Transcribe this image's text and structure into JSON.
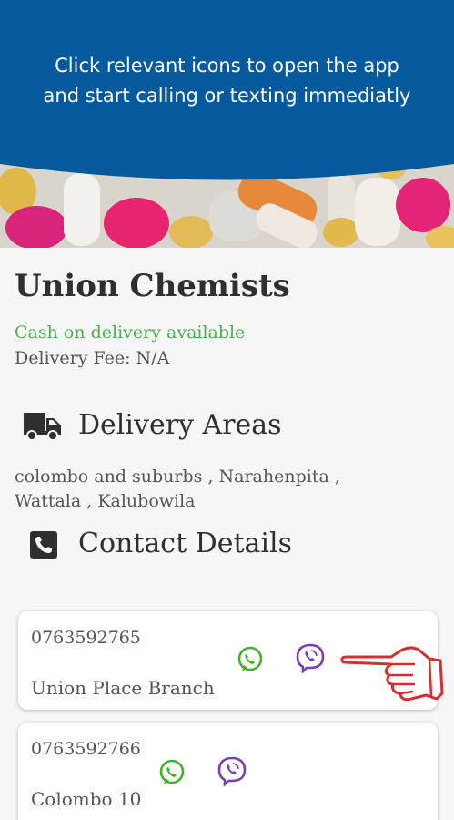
{
  "banner": {
    "message_line1": "Click relevant icons to open the app",
    "message_line2": "and start calling or texting immediatly",
    "color": "#045a9c"
  },
  "shop": {
    "name": "Union Chemists",
    "cod_text": "Cash on delivery available",
    "delivery_fee": "Delivery Fee: N/A"
  },
  "delivery": {
    "heading": "Delivery Areas",
    "icon": "truck-icon",
    "areas_line1": "colombo and suburbs , Narahenpita ,",
    "areas_line2": "Wattala , Kalubowila"
  },
  "contact": {
    "heading": "Contact Details",
    "icon": "phone-icon"
  },
  "contacts": [
    {
      "phone": "0763592765",
      "branch": "Union Place Branch",
      "whatsapp_icon": "whatsapp-icon",
      "viber_icon": "viber-icon"
    },
    {
      "phone": "0763592766",
      "branch": "Colombo 10",
      "whatsapp_icon": "whatsapp-icon",
      "viber_icon": "viber-icon"
    }
  ],
  "colors": {
    "accent_green": "#4caf50",
    "whatsapp": "#43b02a",
    "viber": "#7d3daf",
    "hand_outline": "#d32f2f"
  }
}
